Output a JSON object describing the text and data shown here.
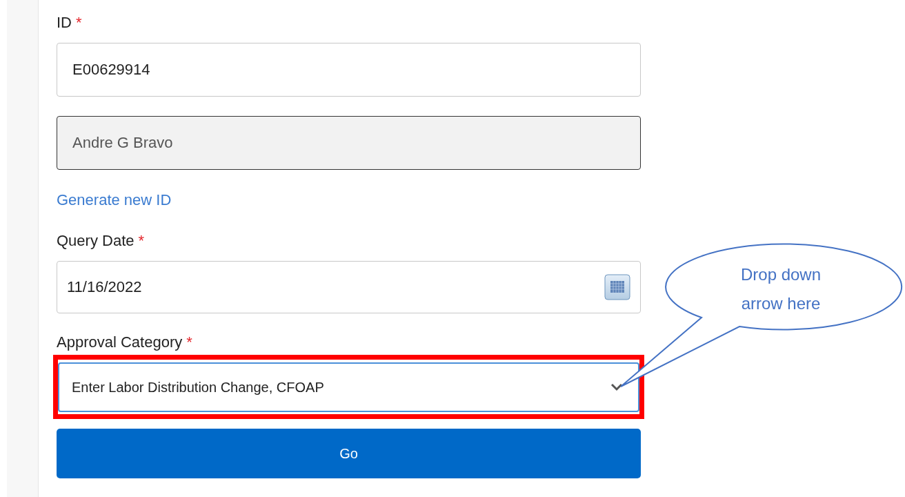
{
  "fields": [
    {
      "kind": "text",
      "label": "ID",
      "required_mark": "*",
      "value": "E00629914"
    },
    {
      "kind": "readonly",
      "value": "Andre G Bravo"
    },
    {
      "kind": "link",
      "text": "Generate new ID"
    },
    {
      "kind": "date",
      "label": "Query Date",
      "required_mark": "*",
      "value": "11/16/2022"
    },
    {
      "kind": "select",
      "label": "Approval Category",
      "required_mark": "*",
      "value": "Enter Labor Distribution Change, CFOAP",
      "highlighted": true
    }
  ],
  "button": {
    "label": "Go"
  },
  "callout": {
    "text": "Drop down arrow here"
  }
}
